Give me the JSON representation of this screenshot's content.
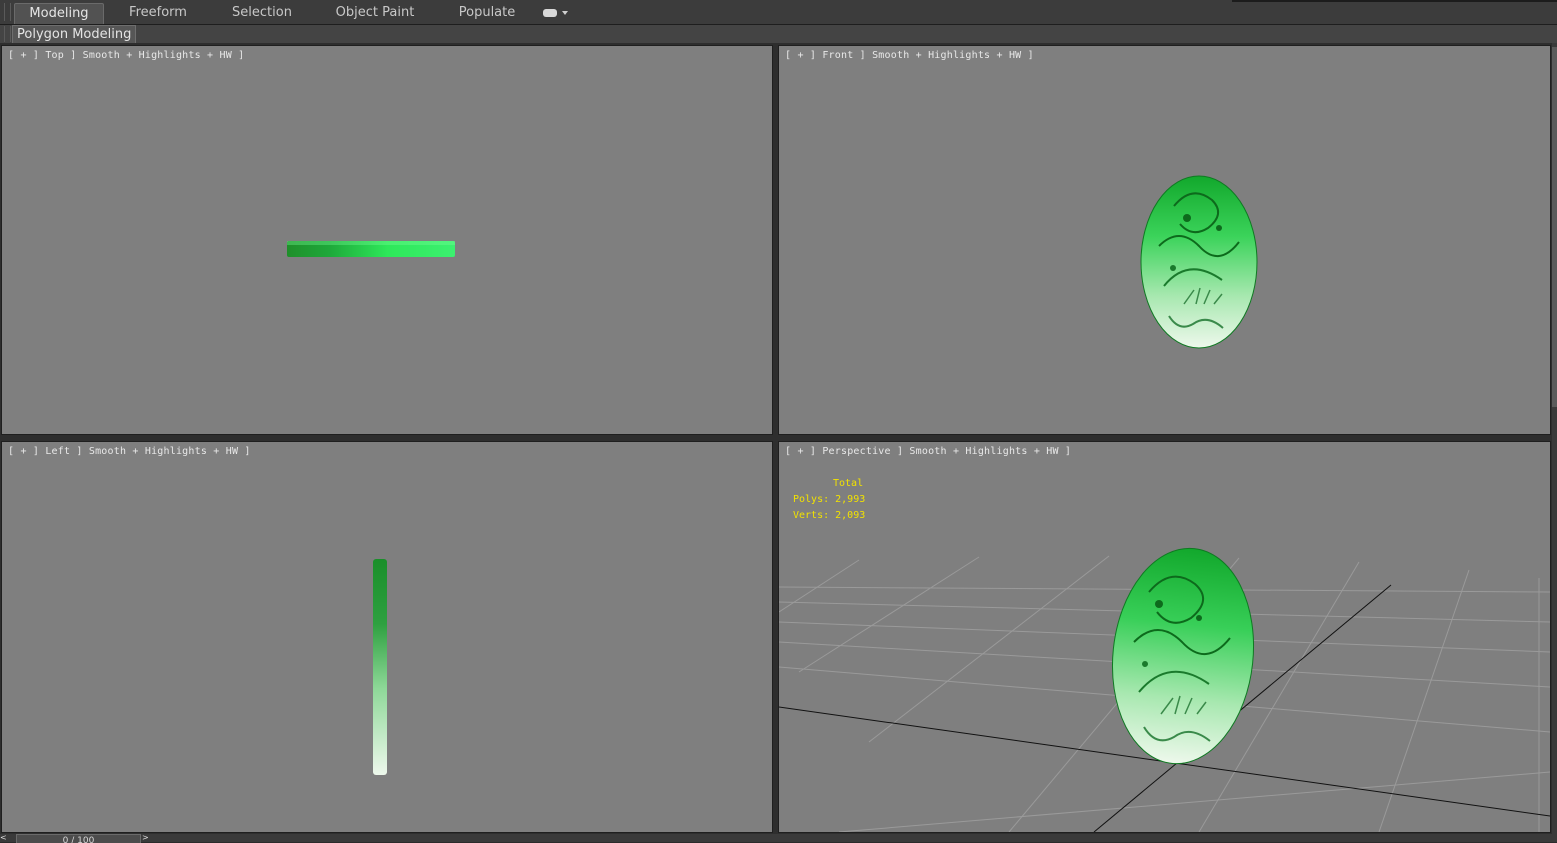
{
  "ribbon": {
    "tabs": [
      {
        "label": "Modeling",
        "active": true
      },
      {
        "label": "Freeform",
        "active": false
      },
      {
        "label": "Selection",
        "active": false
      },
      {
        "label": "Object Paint",
        "active": false
      },
      {
        "label": "Populate",
        "active": false
      }
    ],
    "options_icon": "ribbon-options-icon"
  },
  "panel": {
    "label": "Polygon Modeling"
  },
  "viewports": {
    "top": {
      "label": "[ + ] Top ] Smooth + Highlights + HW ]"
    },
    "front": {
      "label": "[ + ] Front ] Smooth + Highlights + HW ]"
    },
    "left": {
      "label": "[ + ] Left ] Smooth + Highlights + HW ]"
    },
    "perspective": {
      "label": "[ + ] Perspective ] Smooth + Highlights + HW ]",
      "stats": {
        "title": "Total",
        "polys": "Polys: 2,993",
        "verts": "Verts: 2,093"
      }
    }
  },
  "timeslider": {
    "position": "0 / 100",
    "prev": "<",
    "next": ">"
  },
  "colors": {
    "viewport_bg": "#7f7f7f",
    "stats_text": "#f2e200",
    "jade_dark": "#1f8f2a",
    "jade_bright": "#2ef05a",
    "jade_pale": "#e8f5e6"
  }
}
